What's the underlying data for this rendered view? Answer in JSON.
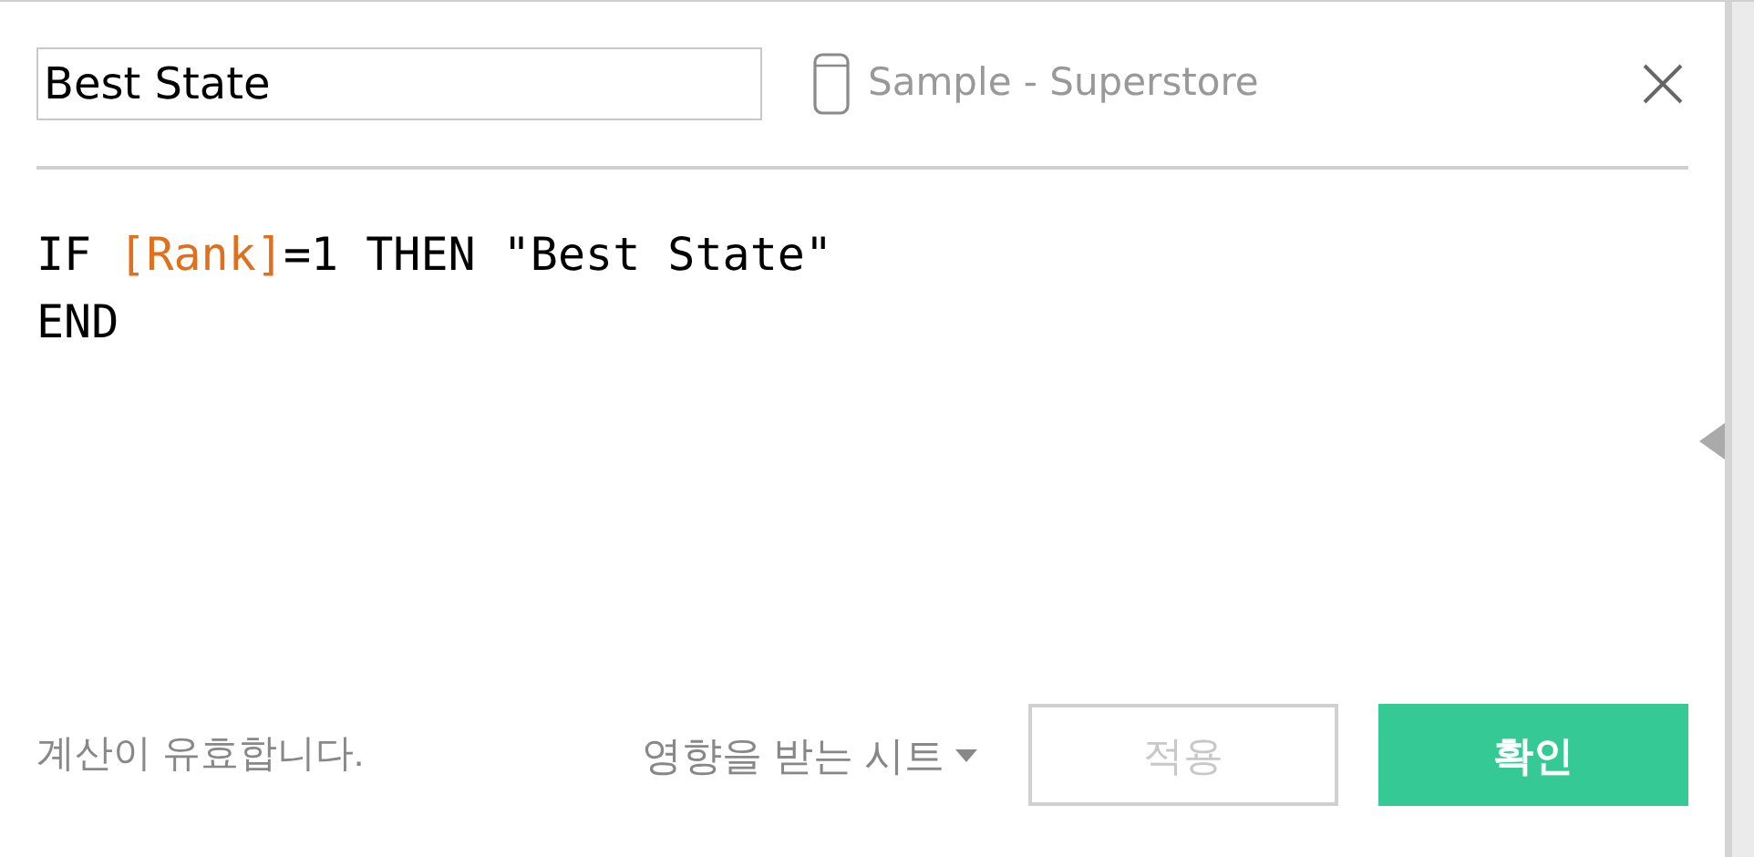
{
  "calc_name": {
    "value": "Best State"
  },
  "data_source": "Sample - Superstore",
  "editor": {
    "lines": [
      [
        {
          "kind": "plain",
          "text": "IF "
        },
        {
          "kind": "field",
          "text": "[Rank]"
        },
        {
          "kind": "plain",
          "text": "=1 THEN \"Best State\""
        }
      ],
      [
        {
          "kind": "plain",
          "text": "END"
        }
      ]
    ]
  },
  "status": "계산이 유효합니다.",
  "affected_sheets": "영향을 받는 시트",
  "buttons": [
    {
      "label": "적용",
      "kind": "secondary",
      "disabled": true
    },
    {
      "label": "확인",
      "kind": "primary",
      "disabled": false
    }
  ]
}
